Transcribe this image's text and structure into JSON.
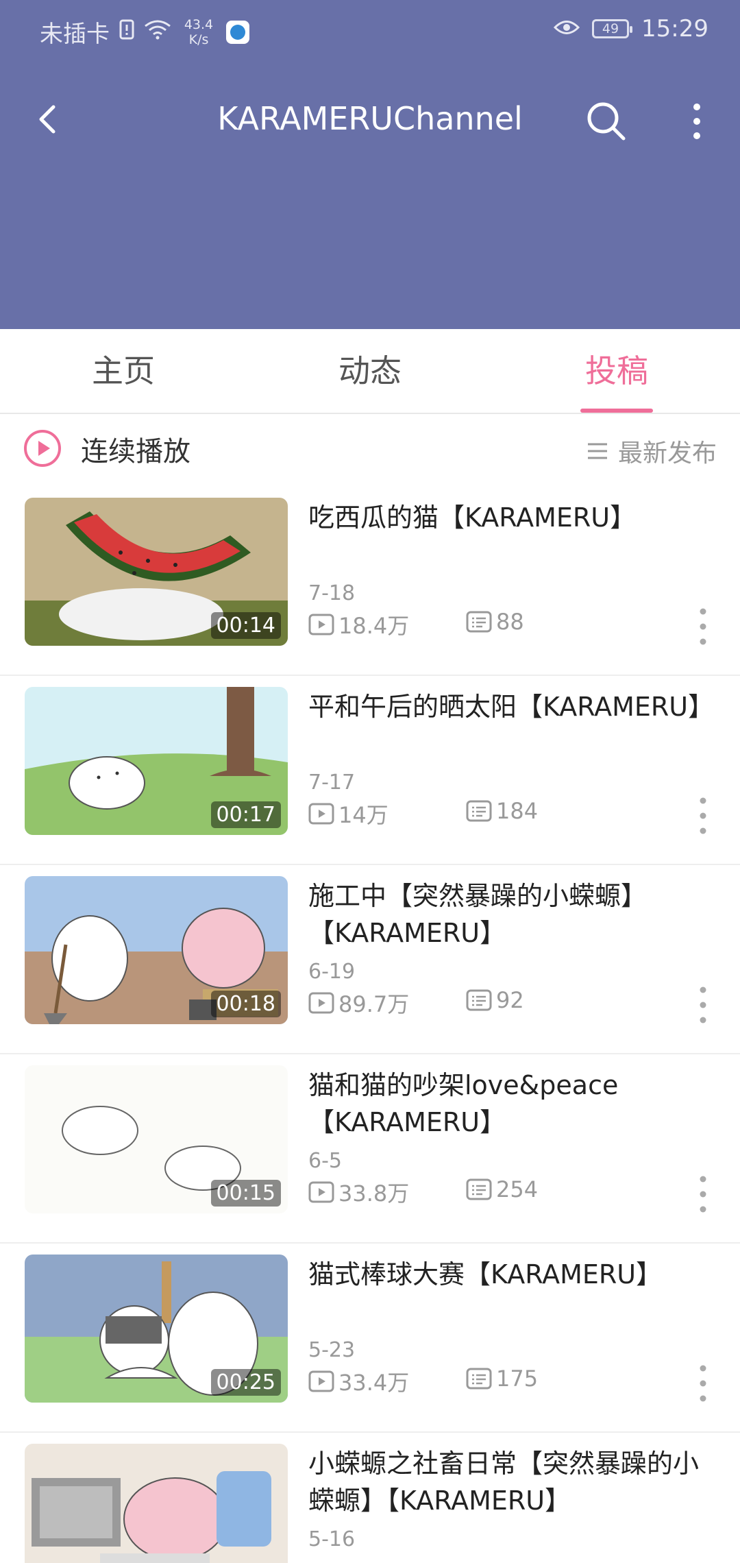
{
  "status_bar": {
    "carrier": "未插卡",
    "speed": "43.4\nK/s",
    "battery": "49",
    "time": "15:29"
  },
  "header": {
    "title": "KARAMERUChannel"
  },
  "tabs": [
    {
      "label": "主页"
    },
    {
      "label": "动态"
    },
    {
      "label": "投稿"
    }
  ],
  "playbar": {
    "label": "连续播放",
    "sort_label": "最新发布"
  },
  "videos": [
    {
      "title": "吃西瓜的猫【KARAMERU】",
      "date": "7-18",
      "views": "18.4万",
      "comments": "88",
      "duration": "00:14"
    },
    {
      "title": "平和午后的晒太阳【KARAMERU】",
      "date": "7-17",
      "views": "14万",
      "comments": "184",
      "duration": "00:17"
    },
    {
      "title": "施工中【突然暴躁的小蝾螈】【KARAMERU】",
      "date": "6-19",
      "views": "89.7万",
      "comments": "92",
      "duration": "00:18"
    },
    {
      "title": "猫和猫的吵架love&peace【KARAMERU】",
      "date": "6-5",
      "views": "33.8万",
      "comments": "254",
      "duration": "00:15"
    },
    {
      "title": "猫式棒球大赛【KARAMERU】",
      "date": "5-23",
      "views": "33.4万",
      "comments": "175",
      "duration": "00:25"
    },
    {
      "title": "小蝾螈之社畜日常【突然暴躁的小蝾螈】【KARAMERU】",
      "date": "5-16",
      "views": "",
      "comments": "",
      "duration": ""
    }
  ],
  "colors": {
    "header_bg": "#6870a8",
    "accent": "#ef6e99"
  }
}
